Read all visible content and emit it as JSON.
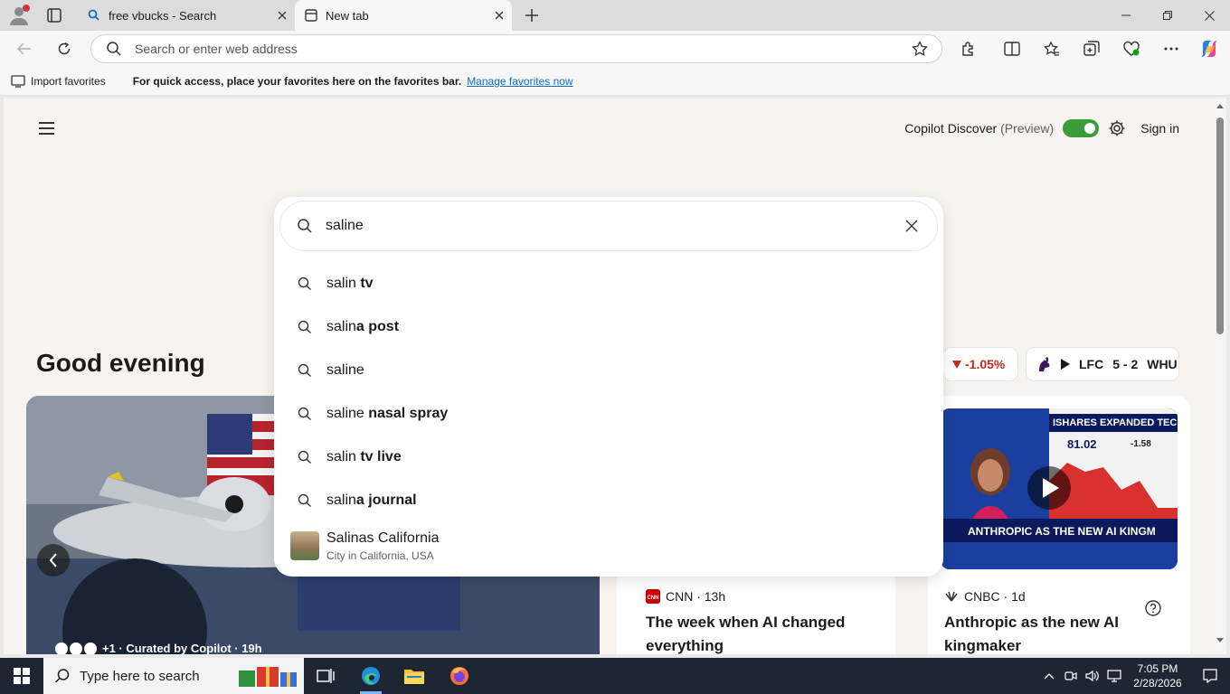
{
  "browser": {
    "tabs": [
      {
        "label": "free vbucks - Search",
        "active": false
      },
      {
        "label": "New tab",
        "active": true
      }
    ],
    "address_placeholder": "Search or enter web address",
    "favorites_bar": {
      "import_label": "Import favorites",
      "message": "For quick access, place your favorites here on the favorites bar.",
      "link": "Manage favorites now"
    }
  },
  "page": {
    "copilot_discover": "Copilot Discover",
    "preview": "(Preview)",
    "sign_in": "Sign in",
    "greeting": "Good evening",
    "stock_change": "-1.05%",
    "score": {
      "home": "LFC",
      "score": "5 - 2",
      "away": "WHU"
    },
    "hero_caption": "+1 · Curated by Copilot · 19h",
    "cards": [
      {
        "source": "CNN · 13h",
        "headline": "The week when AI changed everything"
      },
      {
        "source": "CNBC · 1d",
        "headline": "Anthropic as the new AI kingmaker"
      }
    ],
    "video_ticker": {
      "title": "ISHARES EXPANDED TECH-S",
      "value": "81.02",
      "change": "-1.58",
      "banner": "ANTHROPIC AS THE NEW AI KINGM"
    }
  },
  "search": {
    "query": "saline",
    "suggestions": [
      {
        "prefix": "salin",
        "rest": " tv"
      },
      {
        "prefix": "salin",
        "rest": "a post"
      },
      {
        "prefix": "saline",
        "rest": ""
      },
      {
        "prefix": "saline",
        "rest": " nasal spray"
      },
      {
        "prefix": "salin",
        "rest": " tv live"
      },
      {
        "prefix": "salin",
        "rest": "a journal"
      }
    ],
    "location": {
      "title": "Salinas California",
      "subtitle": "City in California, USA"
    }
  },
  "taskbar": {
    "search_placeholder": "Type here to search",
    "time": "7:05 PM",
    "date": "2/28/2026"
  },
  "colors": {
    "accent": "#0f6cbd",
    "toggle_on": "#3a9d3a",
    "negative": "#c42b1c",
    "taskbar": "#1f2633"
  }
}
